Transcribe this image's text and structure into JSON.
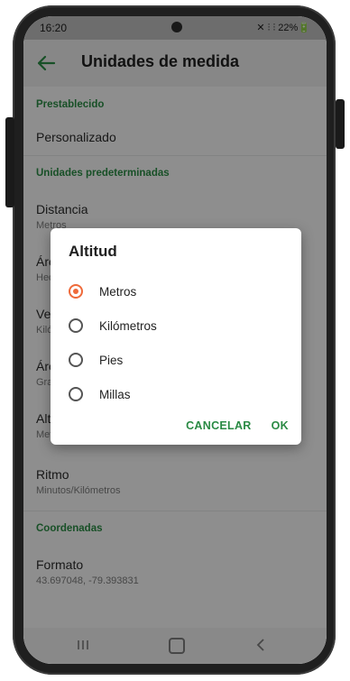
{
  "status_bar": {
    "time": "16:20",
    "icons_text": "✕  ⫶ ⫶ 22%🔋"
  },
  "app_bar": {
    "title": "Unidades de medida",
    "back_icon": "arrow-left-icon"
  },
  "sections": [
    {
      "header": "Prestablecido"
    },
    {
      "header": "Unidades predeterminadas"
    },
    {
      "header": "Coordenadas"
    }
  ],
  "preferences": [
    {
      "title": "Personalizado",
      "subtitle": ""
    },
    {
      "title": "Distancia",
      "subtitle": "Metros"
    },
    {
      "title": "Área",
      "subtitle": "Hectáreas"
    },
    {
      "title": "Velocidad",
      "subtitle": "Kilómetros/hora"
    },
    {
      "title": "Área",
      "subtitle": "Grados"
    },
    {
      "title": "Altitud",
      "subtitle": "Metros"
    },
    {
      "title": "Ritmo",
      "subtitle": "Minutos/Kilómetros"
    },
    {
      "title": "Formato",
      "subtitle": "43.697048, -79.393831"
    }
  ],
  "dialog": {
    "title": "Altitud",
    "options": [
      {
        "label": "Metros",
        "selected": true
      },
      {
        "label": "Kilómetros",
        "selected": false
      },
      {
        "label": "Pies",
        "selected": false
      },
      {
        "label": "Millas",
        "selected": false
      }
    ],
    "cancel_label": "CANCELAR",
    "ok_label": "OK"
  },
  "colors": {
    "accent_green": "#2a8a44",
    "radio_selected": "#ef6a3a"
  },
  "nav_icons": [
    "recents-icon",
    "home-icon",
    "back-icon"
  ]
}
